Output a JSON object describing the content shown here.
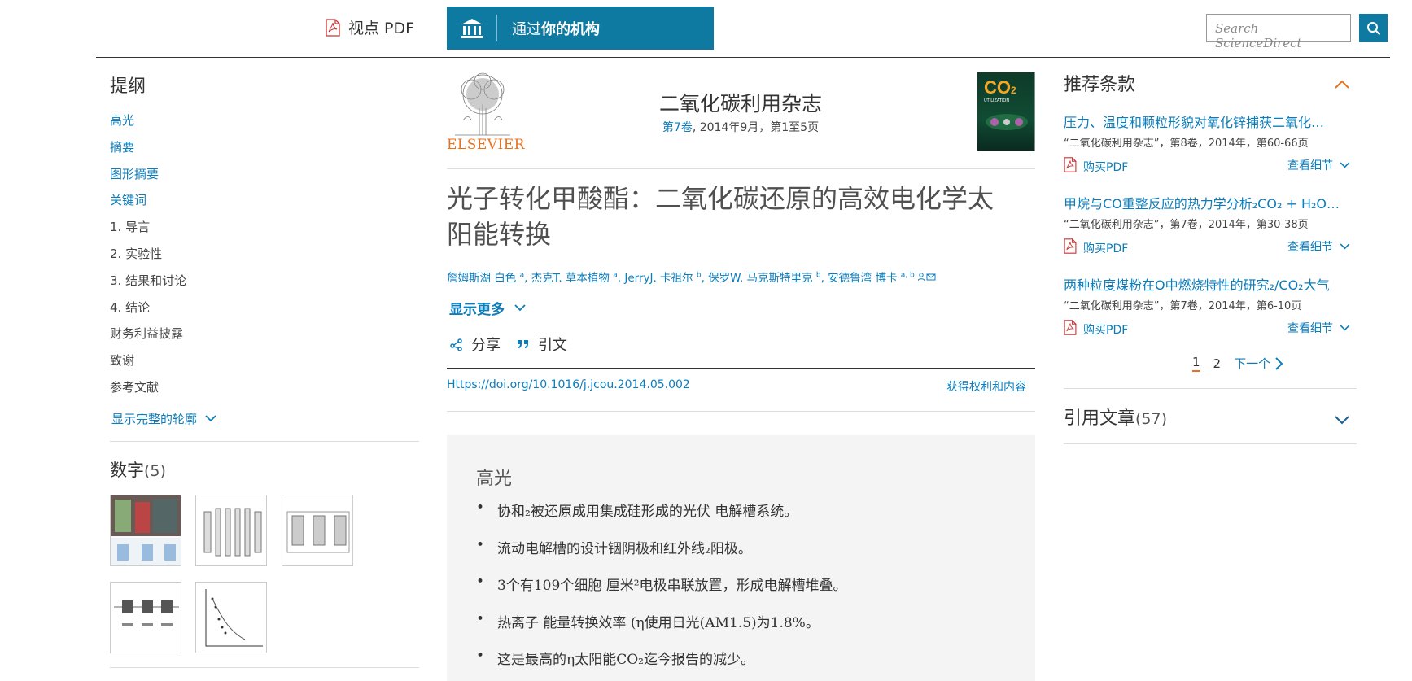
{
  "header": {
    "view_pdf": "视点 PDF",
    "institution_prefix": "通过",
    "institution_bold": "你的机构",
    "search_placeholder": "Search ScienceDirect"
  },
  "outline": {
    "title": "提纲",
    "items": [
      {
        "label": "高光",
        "linked": true
      },
      {
        "label": "摘要",
        "linked": true
      },
      {
        "label": "图形摘要",
        "linked": true
      },
      {
        "label": "关键词",
        "linked": true
      },
      {
        "label": "1. 导言",
        "linked": false
      },
      {
        "label": "2. 实验性",
        "linked": false
      },
      {
        "label": "3. 结果和讨论",
        "linked": false
      },
      {
        "label": "4. 结论",
        "linked": false
      },
      {
        "label": "财务利益披露",
        "linked": false
      },
      {
        "label": "致谢",
        "linked": false
      },
      {
        "label": "参考文献",
        "linked": false
      }
    ],
    "show_full": "显示完整的轮廓"
  },
  "figures": {
    "title": "数字",
    "count": "(5)"
  },
  "journal": {
    "publisher": "ELSEVIER",
    "title": "二氧化碳利用杂志",
    "volume_link": "第7卷",
    "issue_rest": ", 2014年9月，第1至5页",
    "cover_text": "CO",
    "cover_sub": "2",
    "cover_caption": "UTILIZATION"
  },
  "article": {
    "title": "光子转化甲酸酯：二氧化碳还原的高效电化学太阳能转换",
    "authors": [
      {
        "name": "詹姆斯湖 白色",
        "sup": "a"
      },
      {
        "name": "杰克T. 草本植物",
        "sup": "a"
      },
      {
        "name": "JerryJ. 卡祖尔",
        "sup": "b"
      },
      {
        "name": "保罗W. 马克斯特里克",
        "sup": "b"
      },
      {
        "name": "安德鲁湾 博卡",
        "sup": "a, b"
      }
    ],
    "show_more": "显示更多",
    "share": "分享",
    "cite": "引文",
    "doi": "Https://doi.org/10.1016/j.jcou.2014.05.002",
    "rights": "获得权利和内容"
  },
  "highlights": {
    "title": "高光",
    "items": [
      "协和₂被还原成用集成硅形成的光伏 电解槽系统。",
      "流动电解槽的设计铟阴极和红外线₂阳极。",
      "3个有109个细胞 厘米²电极串联放置，形成电解槽堆叠。",
      "热离子 能量转换效率 (η使用日光(AM1.5)为1.8%。",
      "这是最高的η太阳能CO₂迄今报告的减少。"
    ]
  },
  "recommended": {
    "title": "推荐条款",
    "items": [
      {
        "title": "压力、温度和颗粒形貌对氧化锌捕获二氧化…",
        "meta": "“二氧化碳利用杂志”，第8卷，2014年，第60-66页"
      },
      {
        "title": "甲烷与CO重整反应的热力学分析₂CO₂ + H₂O…",
        "meta": "“二氧化碳利用杂志”，第7卷，2014年，第30-38页"
      },
      {
        "title": "两种粒度煤粉在O中燃烧特性的研究₂/CO₂大气",
        "meta": "“二氧化碳利用杂志”，第7卷，2014年，第6-10页"
      }
    ],
    "buy_pdf": "购买PDF",
    "details": "查看细节",
    "pages": [
      "1",
      "2"
    ],
    "next": "下一个"
  },
  "cited": {
    "title": "引用文章",
    "count": "(57)"
  },
  "colors": {
    "brand_blue": "#0e7aa1",
    "link_blue": "#0c7dbb",
    "elsevier_orange": "#e9711c"
  }
}
